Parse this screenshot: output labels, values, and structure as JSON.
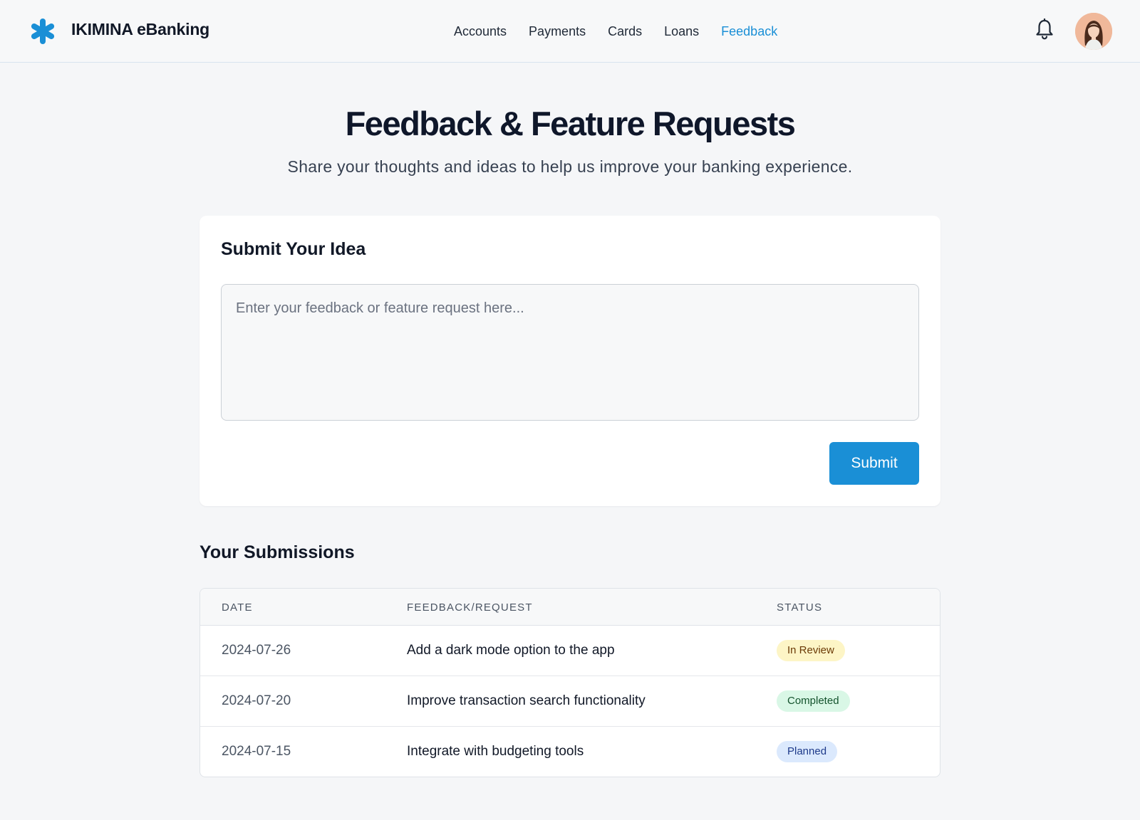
{
  "header": {
    "brand": "IKIMINA eBanking",
    "brand_color": "#1a8fd6",
    "nav": [
      {
        "label": "Accounts"
      },
      {
        "label": "Payments"
      },
      {
        "label": "Cards"
      },
      {
        "label": "Loans"
      },
      {
        "label": "Feedback"
      }
    ],
    "active_nav": "Feedback",
    "icons": [
      "asterisk-logo-icon",
      "bell-icon",
      "user-avatar"
    ]
  },
  "hero": {
    "title": "Feedback & Feature Requests",
    "subtitle": "Share your thoughts and ideas to help us improve your banking experience."
  },
  "submit_card": {
    "title": "Submit Your Idea",
    "input_placeholder": "Enter your feedback or feature request here...",
    "input_value": "",
    "submit_label": "Submit"
  },
  "submissions": {
    "title": "Your Submissions",
    "columns": [
      "DATE",
      "FEEDBACK/REQUEST",
      "STATUS"
    ],
    "rows": [
      {
        "date": "2024-07-26",
        "text": "Add a dark mode option to the app",
        "status": "In Review",
        "status_color": "#fdf5c6"
      },
      {
        "date": "2024-07-20",
        "text": "Improve transaction search functionality",
        "status": "Completed",
        "status_color": "#d9f7e6"
      },
      {
        "date": "2024-07-15",
        "text": "Integrate with budgeting tools",
        "status": "Planned",
        "status_color": "#dbe9fd"
      }
    ]
  }
}
